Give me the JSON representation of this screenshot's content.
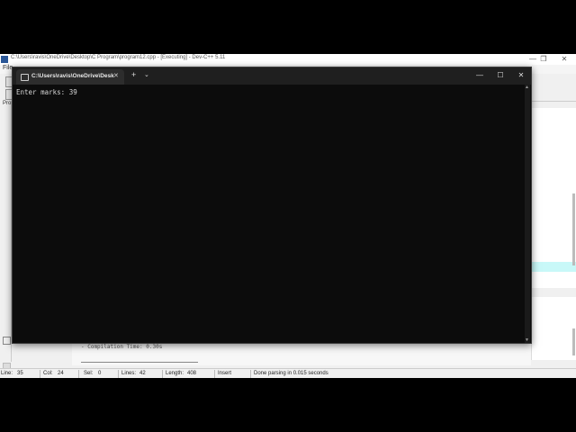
{
  "ide": {
    "title": "C:\\Users\\ravis\\OneDrive\\Desktop\\C Program\\program12.cpp - [Executing] - Dev-C++ 5.11",
    "menu_first": "File",
    "left_panel_label": "Pro",
    "compile_time": "- Compilation Time: 0.30s",
    "controls": {
      "minimize": "—",
      "maximize": "❐",
      "close": "✕"
    }
  },
  "statusbar": {
    "line_label": "Line:",
    "line_value": "35",
    "col_label": "Col:",
    "col_value": "24",
    "sel_label": "Sel:",
    "sel_value": "0",
    "lines_label": "Lines:",
    "lines_value": "42",
    "length_label": "Length:",
    "length_value": "408",
    "mode": "Insert",
    "message": "Done parsing in 0.015 seconds"
  },
  "console": {
    "tab_title": "C:\\Users\\ravis\\OneDrive\\Desk",
    "tab_close": "✕",
    "new_tab": "+",
    "dropdown": "⌄",
    "controls": {
      "minimize": "—",
      "maximize": "☐",
      "close": "✕"
    },
    "output": "Enter marks: 39"
  }
}
